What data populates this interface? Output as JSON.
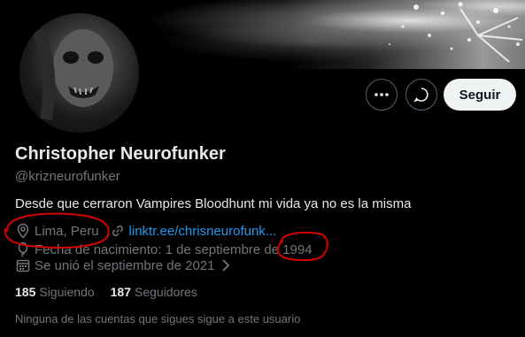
{
  "profile": {
    "name": "Christopher Neurofunker",
    "handle": "@krizneurofunker",
    "bio": "Desde que cerraron Vampires Bloodhunt mi vida ya no es la misma",
    "location": "Lima, Peru",
    "link": "linktr.ee/chrisneurofunk...",
    "birthdate": "Fecha de nacimiento: 1 de septiembre de 1994",
    "joined": "Se unió el septiembre de 2021"
  },
  "actions": {
    "follow_label": "Seguir",
    "more_icon": "more-icon",
    "message_icon": "message-icon"
  },
  "stats": {
    "following_count": "185",
    "following_label": "Siguiendo",
    "followers_count": "187",
    "followers_label": "Seguidores"
  },
  "followers_note": "Ninguna de las cuentas que sigues sigue a este usuario",
  "colors": {
    "background": "#000000",
    "text": "#e7e9ea",
    "muted": "#71767b",
    "link": "#1d9bf0",
    "annotation": "#d60000"
  }
}
